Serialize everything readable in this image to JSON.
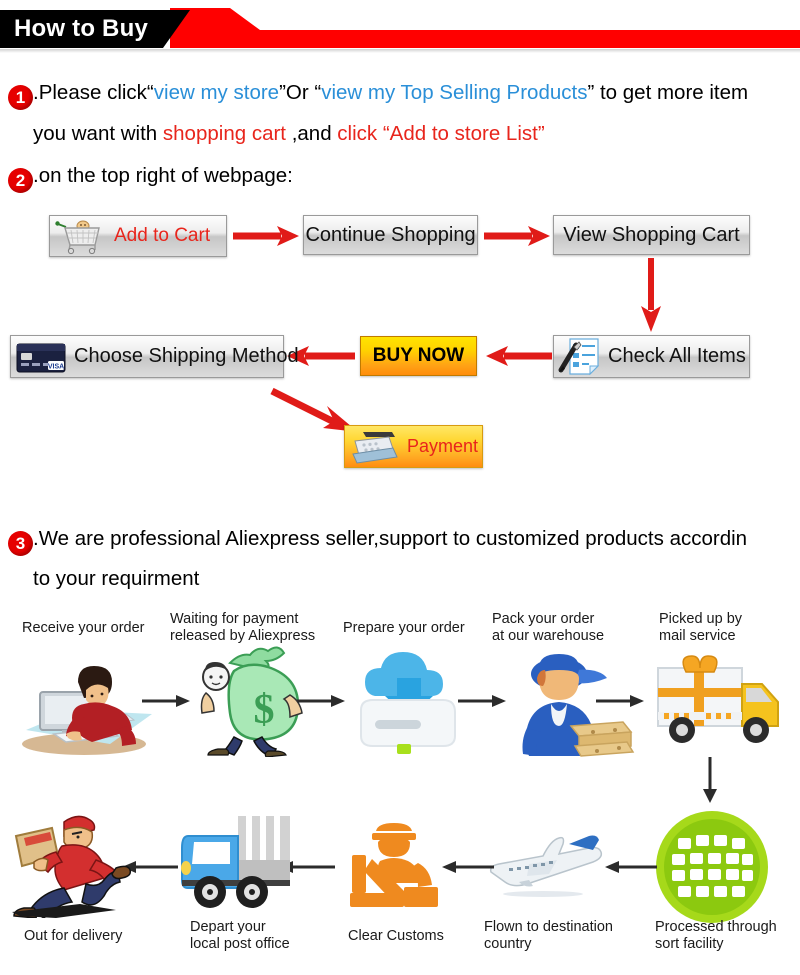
{
  "header": {
    "title": "How to Buy",
    "tab_color": "#000000",
    "bar_color": "#ff0000"
  },
  "steps": {
    "one": {
      "number": "1",
      "line1_a": ".Please click“",
      "line1_link1": "view my store",
      "line1_b": "”Or “",
      "line1_link2": "view my Top Selling Products",
      "line1_c": "” to get more item",
      "line2_a": "you want with ",
      "line2_red1": "shopping cart",
      "line2_b": " ,and ",
      "line2_red2": "click “Add to store List”"
    },
    "two": {
      "number": "2",
      "line1": ".on the top right of webpage:"
    },
    "three": {
      "number": "3",
      "line1": ".We are professional Aliexpress seller,support to customized products accordin",
      "line2": "to your requirment"
    }
  },
  "buy_flow": {
    "add_to_cart": "Add to Cart",
    "continue_shopping": "Continue Shopping",
    "view_shopping_cart": "View Shopping Cart",
    "check_all_items": "Check All Items",
    "buy_now": "BUY NOW",
    "choose_shipping_method": "Choose Shipping Method",
    "payment": "Payment",
    "arrow_color": "#e01b18"
  },
  "shipping_flow": {
    "arrow_color": "#2b2b2b",
    "top_row": [
      {
        "label": "Receive your order",
        "art": "person-at-computer-icon"
      },
      {
        "label": "Waiting for payment\nreleased by Aliexpress",
        "art": "money-bag-man-icon"
      },
      {
        "label": "Prepare your order",
        "art": "download-cloud-icon"
      },
      {
        "label": "Pack your order\nat our warehouse",
        "art": "warehouse-worker-icon"
      },
      {
        "label": "Picked up by\nmail service",
        "art": "delivery-truck-icon"
      }
    ],
    "bottom_row": [
      {
        "label": "Out for delivery",
        "art": "running-courier-icon"
      },
      {
        "label": "Depart your\nlocal post office",
        "art": "post-truck-icon"
      },
      {
        "label": "Clear Customs",
        "art": "customs-officer-icon"
      },
      {
        "label": "Flown to destination\ncountry",
        "art": "airplane-icon"
      },
      {
        "label": "Processed through\nsort facility",
        "art": "globe-grid-icon"
      }
    ]
  }
}
